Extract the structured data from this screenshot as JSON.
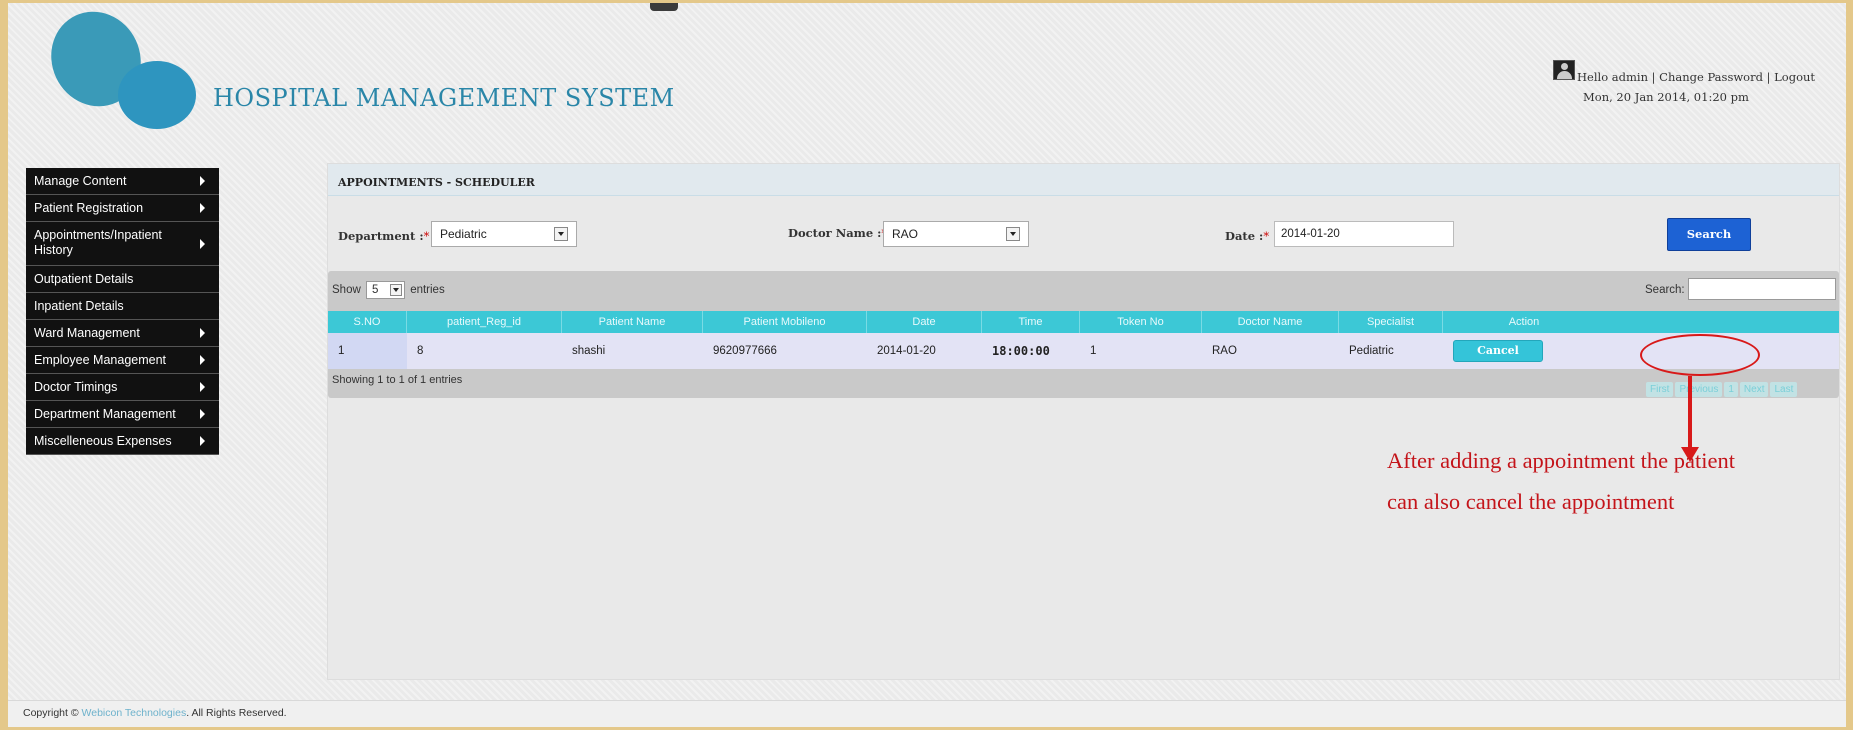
{
  "header": {
    "app_title": "HOSPITAL MANAGEMENT SYSTEM",
    "greeting": "Hello admin",
    "change_password": "Change Password",
    "logout": "Logout",
    "separator": "|",
    "datetime": "Mon, 20 Jan 2014, 01:20 pm"
  },
  "sidebar": {
    "items": [
      {
        "label": "Manage Content",
        "has_arrow": true
      },
      {
        "label": "Patient Registration",
        "has_arrow": true
      },
      {
        "label": "Appointments/Inpatient History",
        "has_arrow": true
      },
      {
        "label": "Outpatient Details",
        "has_arrow": false
      },
      {
        "label": "Inpatient Details",
        "has_arrow": false
      },
      {
        "label": "Ward Management",
        "has_arrow": true
      },
      {
        "label": "Employee Management",
        "has_arrow": true
      },
      {
        "label": "Doctor Timings",
        "has_arrow": true
      },
      {
        "label": "Department Management",
        "has_arrow": true
      },
      {
        "label": "Miscelleneous Expenses",
        "has_arrow": true
      }
    ]
  },
  "main": {
    "panel_title": "APPOINTMENTS - SCHEDULER",
    "filters": {
      "department_label": "Department :",
      "department_value": "Pediatric",
      "doctor_label": "Doctor Name :",
      "doctor_value": "RAO",
      "date_label": "Date :",
      "date_value": "2014-01-20",
      "required_mark": "*",
      "search_button": "Search"
    },
    "table": {
      "show_label": "Show",
      "entries_count": "5",
      "entries_label": "entries",
      "search_label": "Search:",
      "columns": [
        "S.NO",
        "patient_Reg_id",
        "Patient Name",
        "Patient Mobileno",
        "Date",
        "Time",
        "Token No",
        "Doctor Name",
        "Specialist",
        "Action"
      ],
      "rows": [
        {
          "sno": "1",
          "reg_id": "8",
          "name": "shashi",
          "mobile": "9620977666",
          "date": "2014-01-20",
          "time": "18:00:00",
          "token": "1",
          "doctor": "RAO",
          "specialist": "Pediatric",
          "action": "Cancel"
        }
      ],
      "showing": "Showing 1 to 1 of 1 entries",
      "pagination": [
        "First",
        "Previous",
        "1",
        "Next",
        "Last"
      ]
    }
  },
  "annotation": {
    "line1": "After adding a appointment the patient",
    "line2": "can also cancel the appointment",
    "color": "#c4141a"
  },
  "footer": {
    "prefix": "Copyright © ",
    "company": "Webicon Technologies",
    "suffix": ". All Rights Reserved."
  }
}
